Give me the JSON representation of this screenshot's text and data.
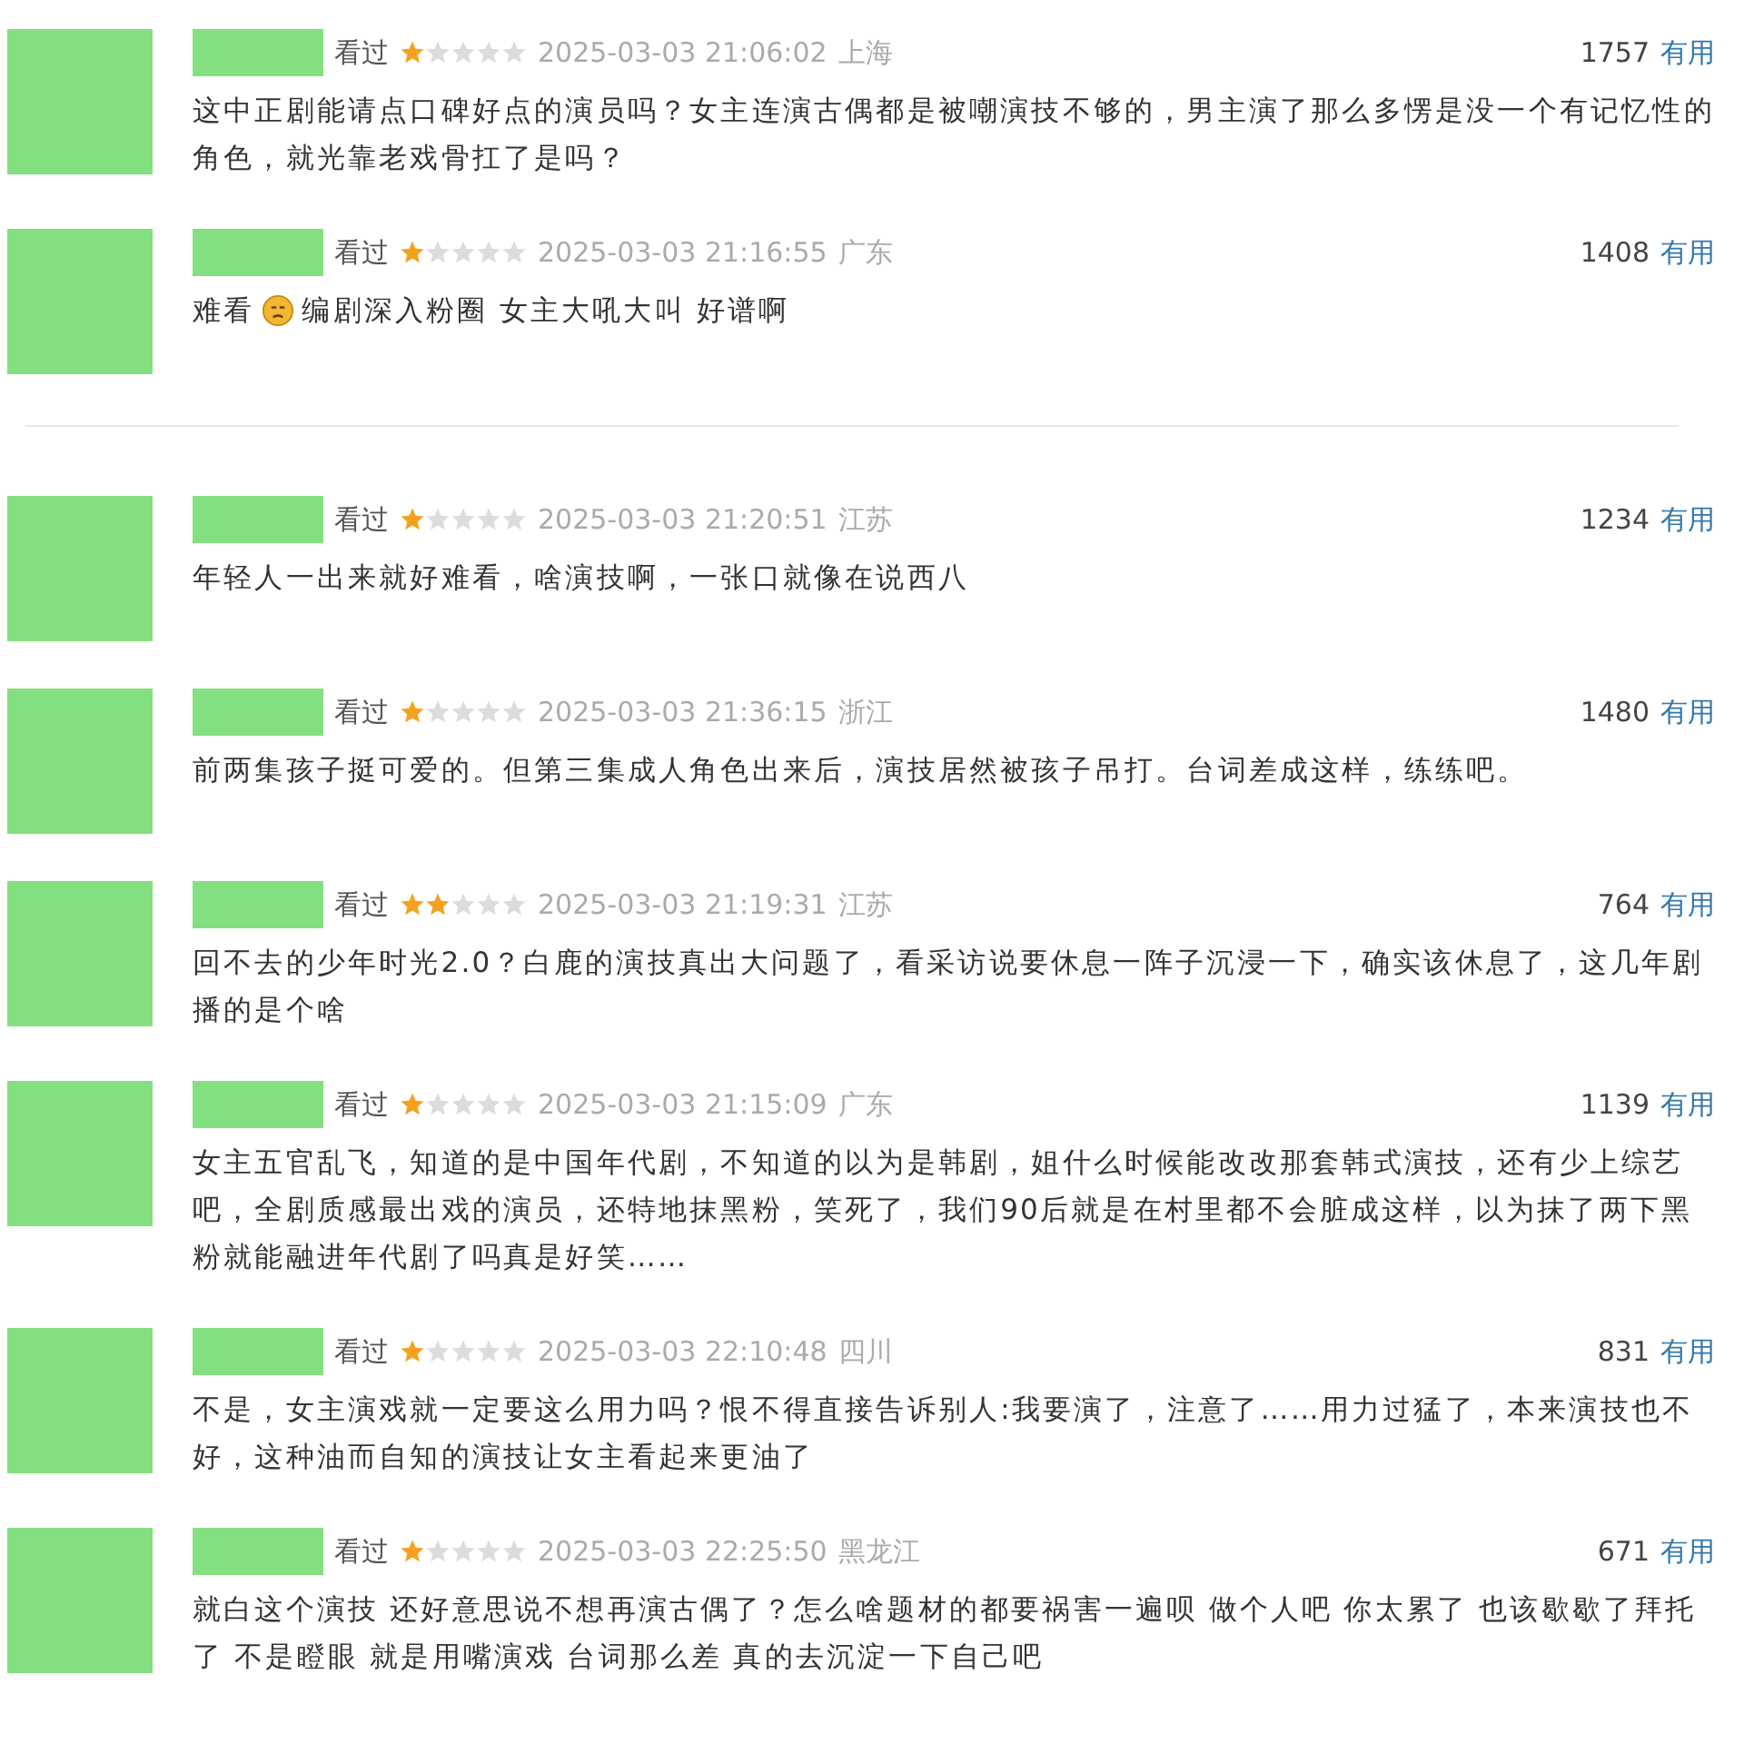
{
  "comments": [
    {
      "status": "看过",
      "stars": 1,
      "time": "2025-03-03 21:06:02",
      "location": "上海",
      "votes": "1757",
      "vote_label": "有用",
      "text": "这中正剧能请点口碑好点的演员吗？女主连演古偶都是被嘲演技不够的，男主演了那么多愣是没一个有记忆性的角色，就光靠老戏骨扛了是吗？"
    },
    {
      "status": "看过",
      "stars": 1,
      "time": "2025-03-03 21:16:55",
      "location": "广东",
      "votes": "1408",
      "vote_label": "有用",
      "text": "难看",
      "emoji": true,
      "text_after": "编剧深入粉圈 女主大吼大叫 好谱啊",
      "divider_after": true
    },
    {
      "status": "看过",
      "stars": 1,
      "time": "2025-03-03 21:20:51",
      "location": "江苏",
      "votes": "1234",
      "vote_label": "有用",
      "text": "年轻人一出来就好难看，啥演技啊，一张口就像在说西八"
    },
    {
      "status": "看过",
      "stars": 1,
      "time": "2025-03-03 21:36:15",
      "location": "浙江",
      "votes": "1480",
      "vote_label": "有用",
      "text": "前两集孩子挺可爱的。但第三集成人角色出来后，演技居然被孩子吊打。台词差成这样，练练吧。"
    },
    {
      "status": "看过",
      "stars": 2,
      "time": "2025-03-03 21:19:31",
      "location": "江苏",
      "votes": "764",
      "vote_label": "有用",
      "text": "回不去的少年时光2.0？白鹿的演技真出大问题了，看采访说要休息一阵子沉浸一下，确实该休息了，这几年剧播的是个啥"
    },
    {
      "status": "看过",
      "stars": 1,
      "time": "2025-03-03 21:15:09",
      "location": "广东",
      "votes": "1139",
      "vote_label": "有用",
      "text": "女主五官乱飞，知道的是中国年代剧，不知道的以为是韩剧，姐什么时候能改改那套韩式演技，还有少上综艺吧，全剧质感最出戏的演员，还特地抹黑粉，笑死了，我们90后就是在村里都不会脏成这样，以为抹了两下黑粉就能融进年代剧了吗真是好笑……"
    },
    {
      "status": "看过",
      "stars": 1,
      "time": "2025-03-03 22:10:48",
      "location": "四川",
      "votes": "831",
      "vote_label": "有用",
      "text": "不是，女主演戏就一定要这么用力吗？恨不得直接告诉别人:我要演了，注意了……用力过猛了，本来演技也不好，这种油而自知的演技让女主看起来更油了"
    },
    {
      "status": "看过",
      "stars": 1,
      "time": "2025-03-03 22:25:50",
      "location": "黑龙江",
      "votes": "671",
      "vote_label": "有用",
      "text": "就白这个演技 还好意思说不想再演古偶了？怎么啥题材的都要祸害一遍呗 做个人吧 你太累了 也该歇歇了拜托了 不是瞪眼 就是用嘴演戏 台词那么差 真的去沉淀一下自己吧"
    }
  ]
}
